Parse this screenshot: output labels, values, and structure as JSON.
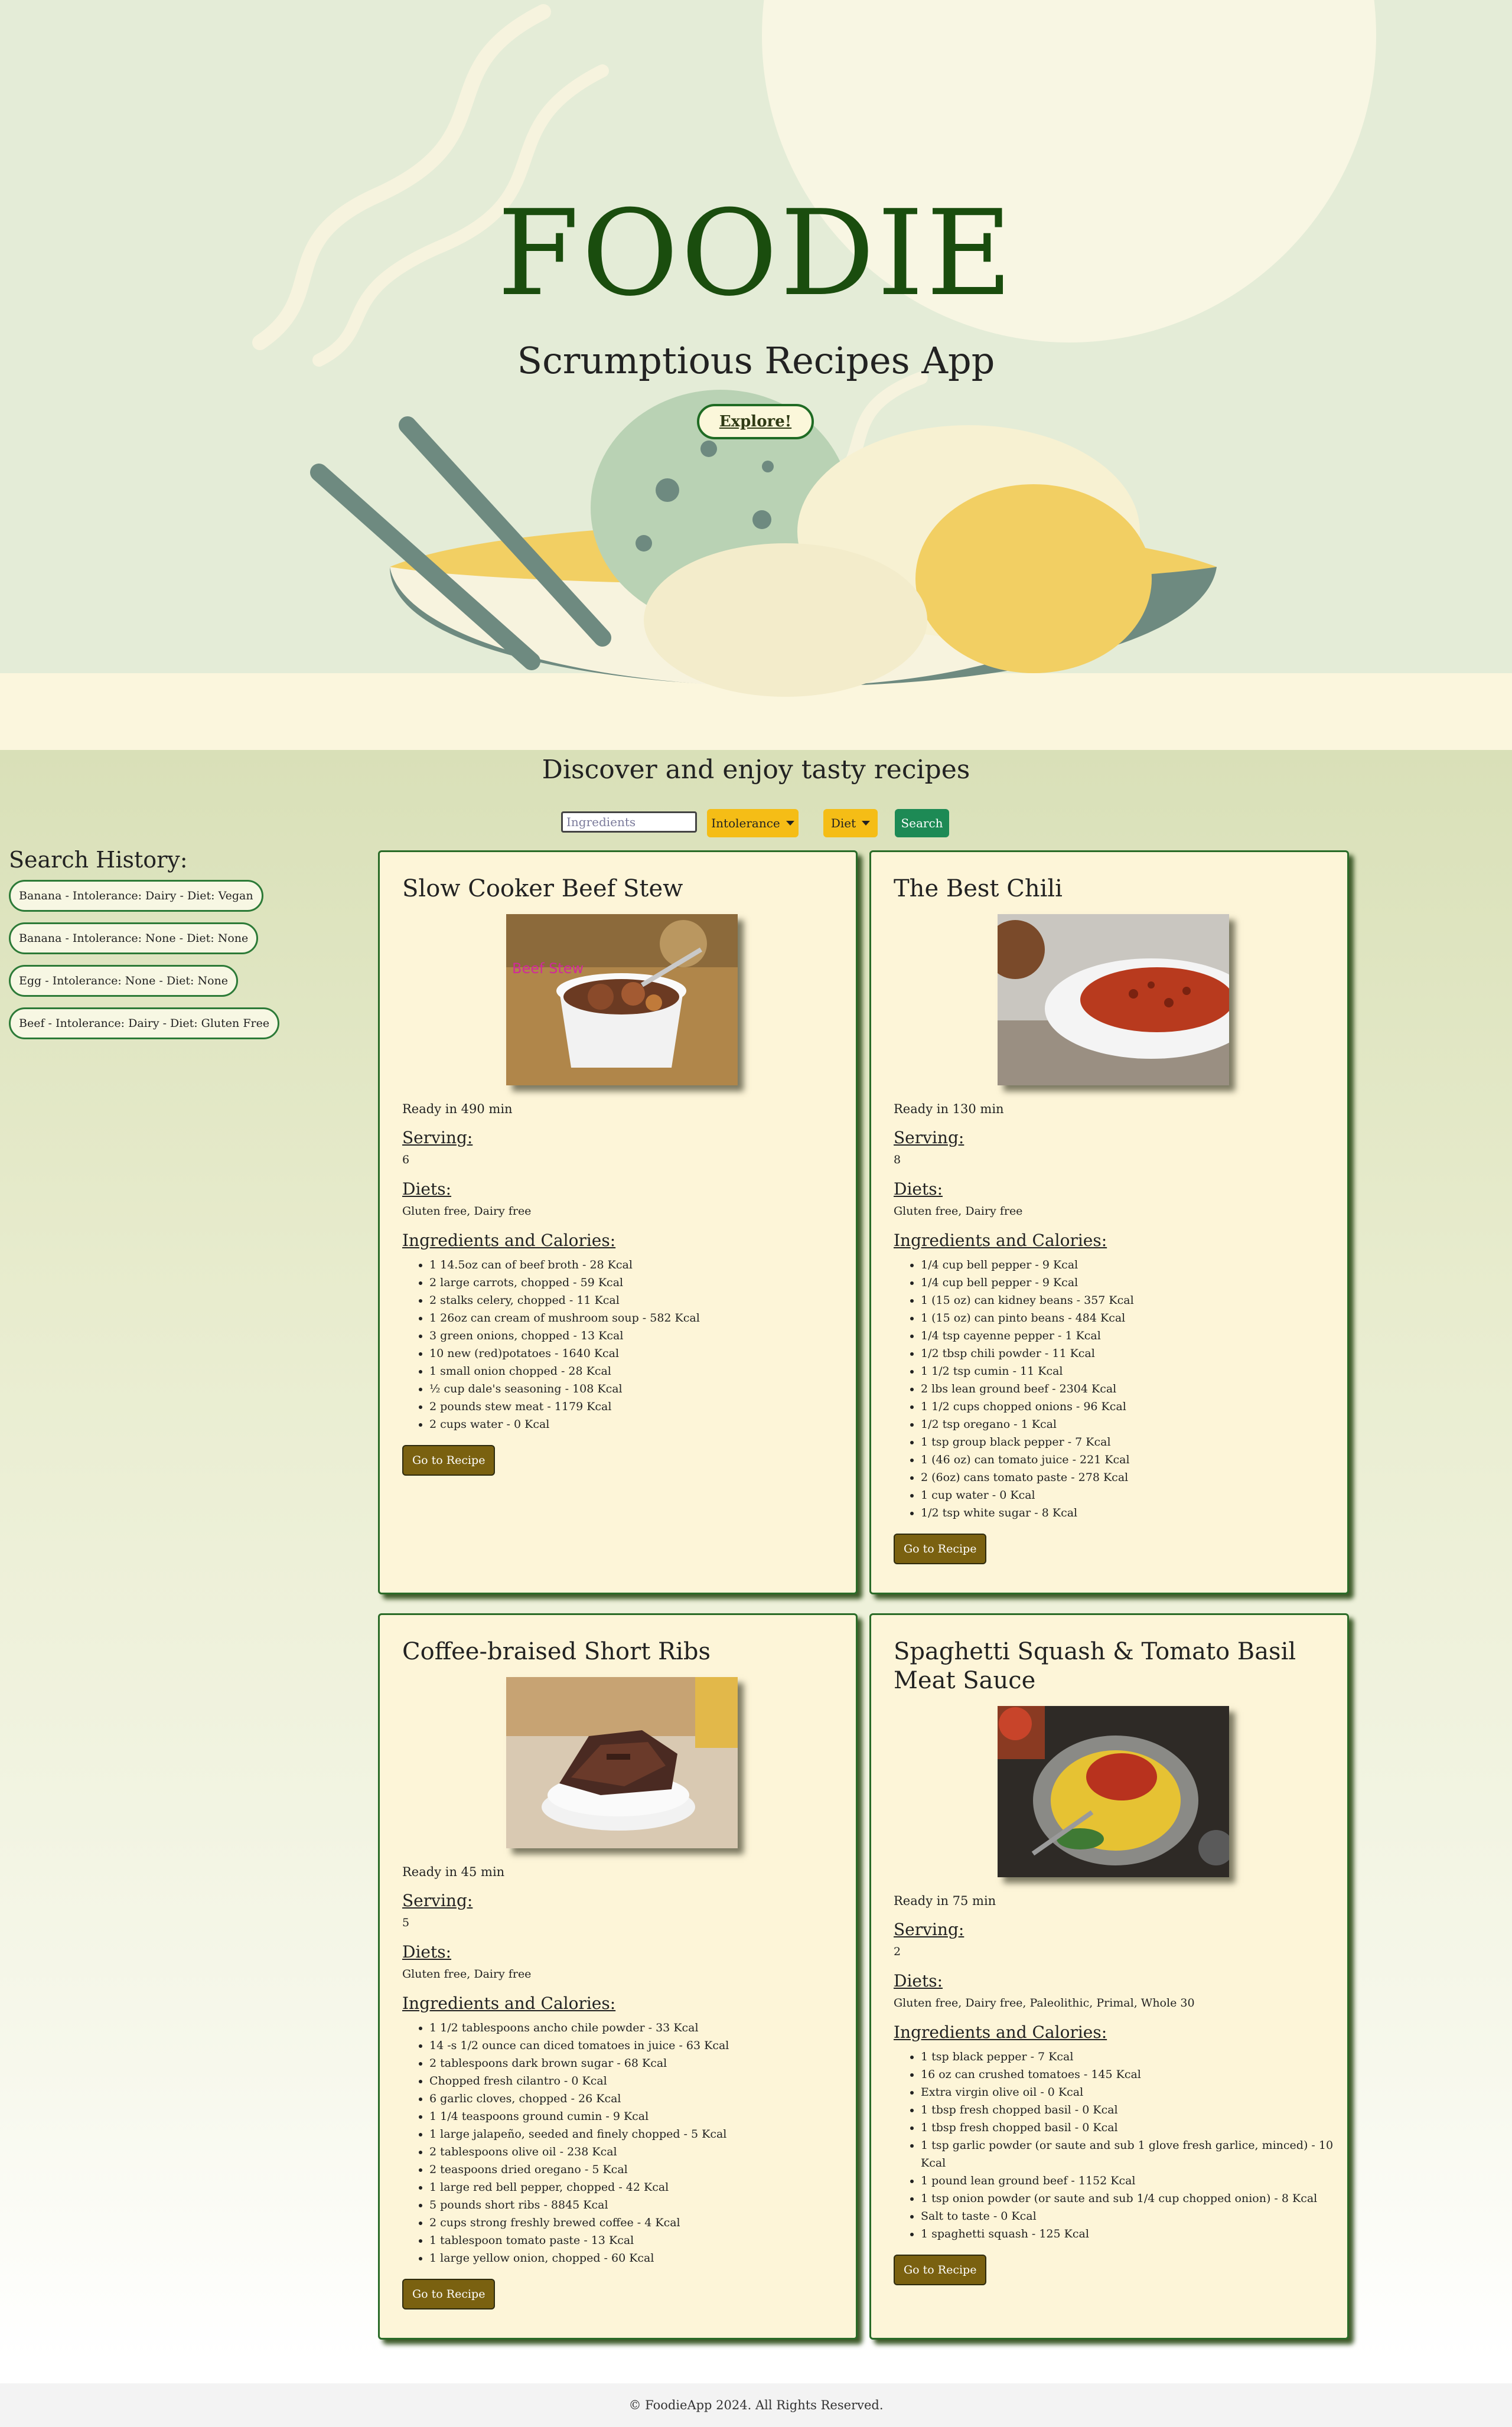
{
  "hero": {
    "title": "FOODIE",
    "subtitle": "Scrumptious Recipes App",
    "explore_label": "Explore!"
  },
  "tagline": "Discover and enjoy tasty recipes",
  "search": {
    "placeholder": "Ingredients",
    "intolerance_label": "Intolerance",
    "diet_label": "Diet",
    "search_label": "Search"
  },
  "history": {
    "title": "Search History:",
    "items": [
      "Banana - Intolerance: Dairy - Diet: Vegan",
      "Banana - Intolerance: None - Diet: None",
      "Egg - Intolerance: None - Diet: None",
      "Beef - Intolerance: Dairy - Diet: Gluten Free"
    ]
  },
  "labels": {
    "serving": "Serving:",
    "diets": "Diets:",
    "ingredients": "Ingredients and Calories:",
    "go": "Go to Recipe"
  },
  "recipes": [
    {
      "title": "Slow Cooker Beef Stew",
      "image_caption": "Beef Stew",
      "ready": "Ready in 490 min",
      "serving": "6",
      "diets": "Gluten free, Dairy free",
      "ingredients": [
        "1 14.5oz can of beef broth - 28 Kcal",
        "2 large carrots, chopped - 59 Kcal",
        "2 stalks celery, chopped - 11 Kcal",
        "1 26oz can cream of mushroom soup - 582 Kcal",
        "3 green onions, chopped - 13 Kcal",
        "10 new (red)potatoes - 1640 Kcal",
        "1 small onion chopped - 28 Kcal",
        "½ cup dale's seasoning - 108 Kcal",
        "2 pounds stew meat - 1179 Kcal",
        "2 cups water - 0 Kcal"
      ]
    },
    {
      "title": "The Best Chili",
      "ready": "Ready in 130 min",
      "serving": "8",
      "diets": "Gluten free, Dairy free",
      "ingredients": [
        "1/4 cup bell pepper - 9 Kcal",
        "1/4 cup bell pepper - 9 Kcal",
        "1 (15 oz) can kidney beans - 357 Kcal",
        "1 (15 oz) can pinto beans - 484 Kcal",
        "1/4 tsp cayenne pepper - 1 Kcal",
        "1/2 tbsp chili powder - 11 Kcal",
        "1 1/2 tsp cumin - 11 Kcal",
        "2 lbs lean ground beef - 2304 Kcal",
        "1 1/2 cups chopped onions - 96 Kcal",
        "1/2 tsp oregano - 1 Kcal",
        "1 tsp group black pepper - 7 Kcal",
        "1 (46 oz) can tomato juice - 221 Kcal",
        "2 (6oz) cans tomato paste - 278 Kcal",
        "1 cup water - 0 Kcal",
        "1/2 tsp white sugar - 8 Kcal"
      ]
    },
    {
      "title": "Coffee-braised Short Ribs",
      "ready": "Ready in 45 min",
      "serving": "5",
      "diets": "Gluten free, Dairy free",
      "ingredients": [
        "1 1/2 tablespoons ancho chile powder - 33 Kcal",
        "14 -s 1/2 ounce can diced tomatoes in juice - 63 Kcal",
        "2 tablespoons dark brown sugar - 68 Kcal",
        "Chopped fresh cilantro - 0 Kcal",
        "6 garlic cloves, chopped - 26 Kcal",
        "1 1/4 teaspoons ground cumin - 9 Kcal",
        "1 large jalapeño, seeded and finely chopped - 5 Kcal",
        "2 tablespoons olive oil - 238 Kcal",
        "2 teaspoons dried oregano - 5 Kcal",
        "1 large red bell pepper, chopped - 42 Kcal",
        "5 pounds short ribs - 8845 Kcal",
        "2 cups strong freshly brewed coffee - 4 Kcal",
        "1 tablespoon tomato paste - 13 Kcal",
        "1 large yellow onion, chopped - 60 Kcal"
      ]
    },
    {
      "title": "Spaghetti Squash & Tomato Basil Meat Sauce",
      "ready": "Ready in 75 min",
      "serving": "2",
      "diets": "Gluten free, Dairy free, Paleolithic, Primal, Whole 30",
      "ingredients": [
        "1 tsp black pepper - 7 Kcal",
        "16 oz can crushed tomatoes - 145 Kcal",
        "Extra virgin olive oil - 0 Kcal",
        "1 tbsp fresh chopped basil - 0 Kcal",
        "1 tbsp fresh chopped basil - 0 Kcal",
        "1 tsp garlic powder (or saute and sub 1 glove fresh garlice, minced) - 10 Kcal",
        "1 pound lean ground beef - 1152 Kcal",
        "1 tsp onion powder (or saute and sub 1/4 cup chopped onion) - 8 Kcal",
        "Salt to taste - 0 Kcal",
        "1 spaghetti squash - 125 Kcal"
      ]
    }
  ],
  "footer": "© FoodieApp 2024. All Rights Reserved.",
  "colors": {
    "hero_title": "#1a4d0e",
    "card_bg": "#fdf5d8",
    "card_border": "#2a6b28",
    "dropdown": "#f5bd16",
    "search_button": "#1d8a55",
    "go_button": "#7a6110"
  }
}
